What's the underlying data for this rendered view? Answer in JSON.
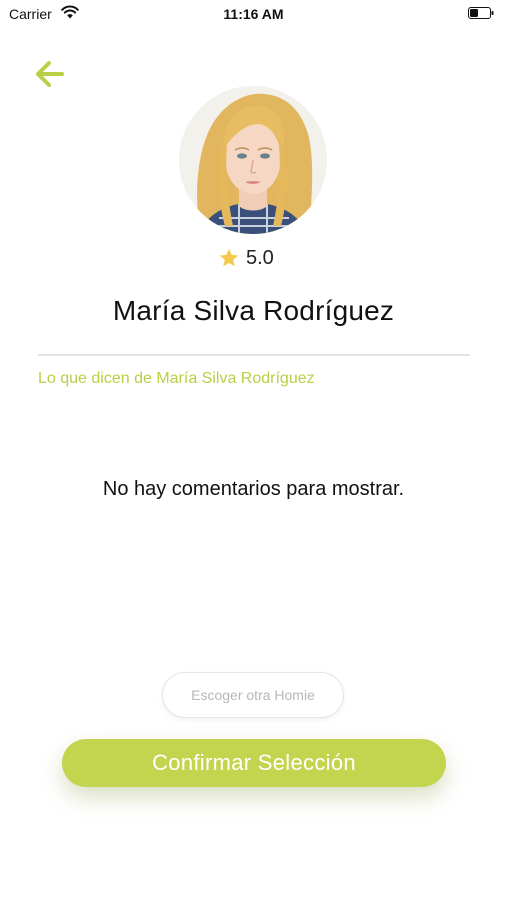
{
  "status_bar": {
    "carrier": "Carrier",
    "time": "11:16 AM",
    "wifi_icon": "wifi-icon",
    "battery_icon": "battery-icon"
  },
  "header": {
    "back_icon": "arrow-left-icon"
  },
  "profile": {
    "rating": "5.0",
    "rating_icon": "star-icon",
    "name": "María Silva Rodríguez"
  },
  "reviews": {
    "title": "Lo que dicen de María Silva Rodríguez",
    "empty_message": "No hay comentarios para mostrar."
  },
  "actions": {
    "secondary_label": "Escoger otra Homie",
    "primary_label": "Confirmar Selección"
  },
  "colors": {
    "accent": "#c3d54e",
    "accent_text": "#b9cf45",
    "star": "#f5c94a"
  }
}
